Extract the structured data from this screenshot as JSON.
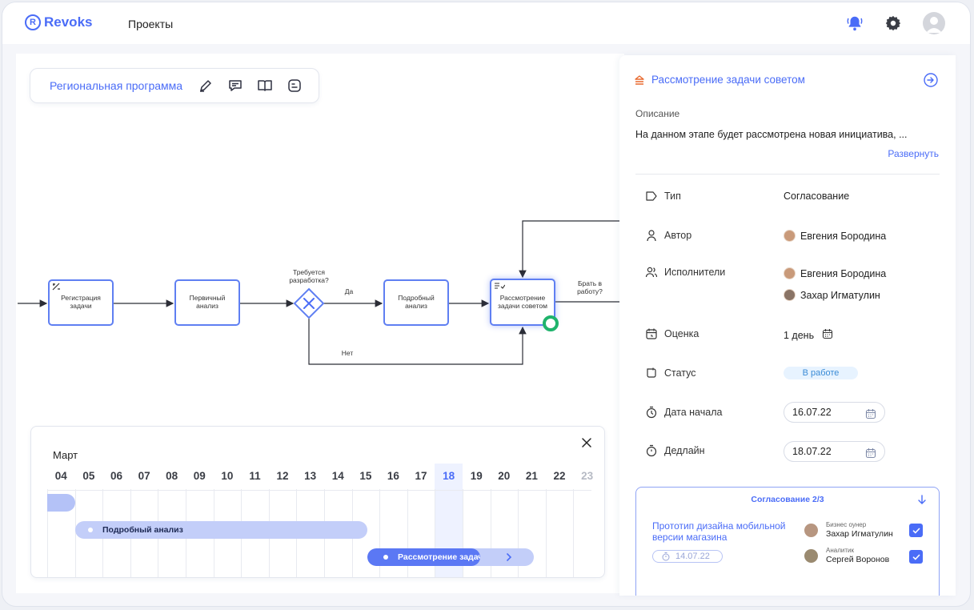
{
  "header": {
    "logo_text": "Revoks",
    "logo_mark": "R",
    "nav_projects": "Проекты",
    "icons": [
      "bell-icon",
      "gear-icon",
      "user-avatar-icon"
    ],
    "accent": "#4a6cf7"
  },
  "toolbar": {
    "title": "Региональная программа",
    "icons": [
      "edit-icon",
      "comment-icon",
      "book-icon",
      "list-icon"
    ]
  },
  "diagram": {
    "nodes": [
      {
        "label": "Регистрация задачи"
      },
      {
        "label": "Первичный анализ"
      },
      {
        "label": "Подробный анализ"
      },
      {
        "label": "Рассмотрение задачи советом"
      }
    ],
    "gateway_label": "Требуется разработка?",
    "yes_label": "Да",
    "no_label": "Нет",
    "take_label": "Брать в работу?"
  },
  "timeline": {
    "month": "Март",
    "days": [
      "04",
      "05",
      "06",
      "07",
      "08",
      "09",
      "10",
      "11",
      "12",
      "13",
      "14",
      "15",
      "16",
      "17",
      "18",
      "19",
      "20",
      "21",
      "22",
      "23"
    ],
    "today": "18",
    "bars": [
      {
        "label": ""
      },
      {
        "label": "Подробный анализ"
      },
      {
        "label": "Рассмотрение задач"
      }
    ]
  },
  "panel": {
    "title": "Рассмотрение задачи советом",
    "description_label": "Описание",
    "description": "На данном этапе будет рассмотрена новая инициатива, ...",
    "expand": "Развернуть",
    "fields": {
      "type_label": "Тип",
      "type_value": "Согласование",
      "author_label": "Автор",
      "author_value": "Евгения Бородина",
      "assignees_label": "Исполнители",
      "assignee_1": "Евгения Бородина",
      "assignee_2": "Захар Игматулин",
      "estimate_label": "Оценка",
      "estimate_value": "1 день",
      "status_label": "Статус",
      "status_value": "В работе",
      "start_label": "Дата начала",
      "start_value": "16.07.22",
      "deadline_label": "Дедлайн",
      "deadline_value": "18.07.22"
    },
    "approval": {
      "header": "Согласование  2/3",
      "task": "Прототип дизайна мобильной версии магазина",
      "date": "14.07.22",
      "people": [
        {
          "role": "Бизнес оунер",
          "name": "Захар Игматулин",
          "checked": true
        },
        {
          "role": "Аналитик",
          "name": "Сергей Воронов",
          "checked": true
        }
      ]
    }
  }
}
